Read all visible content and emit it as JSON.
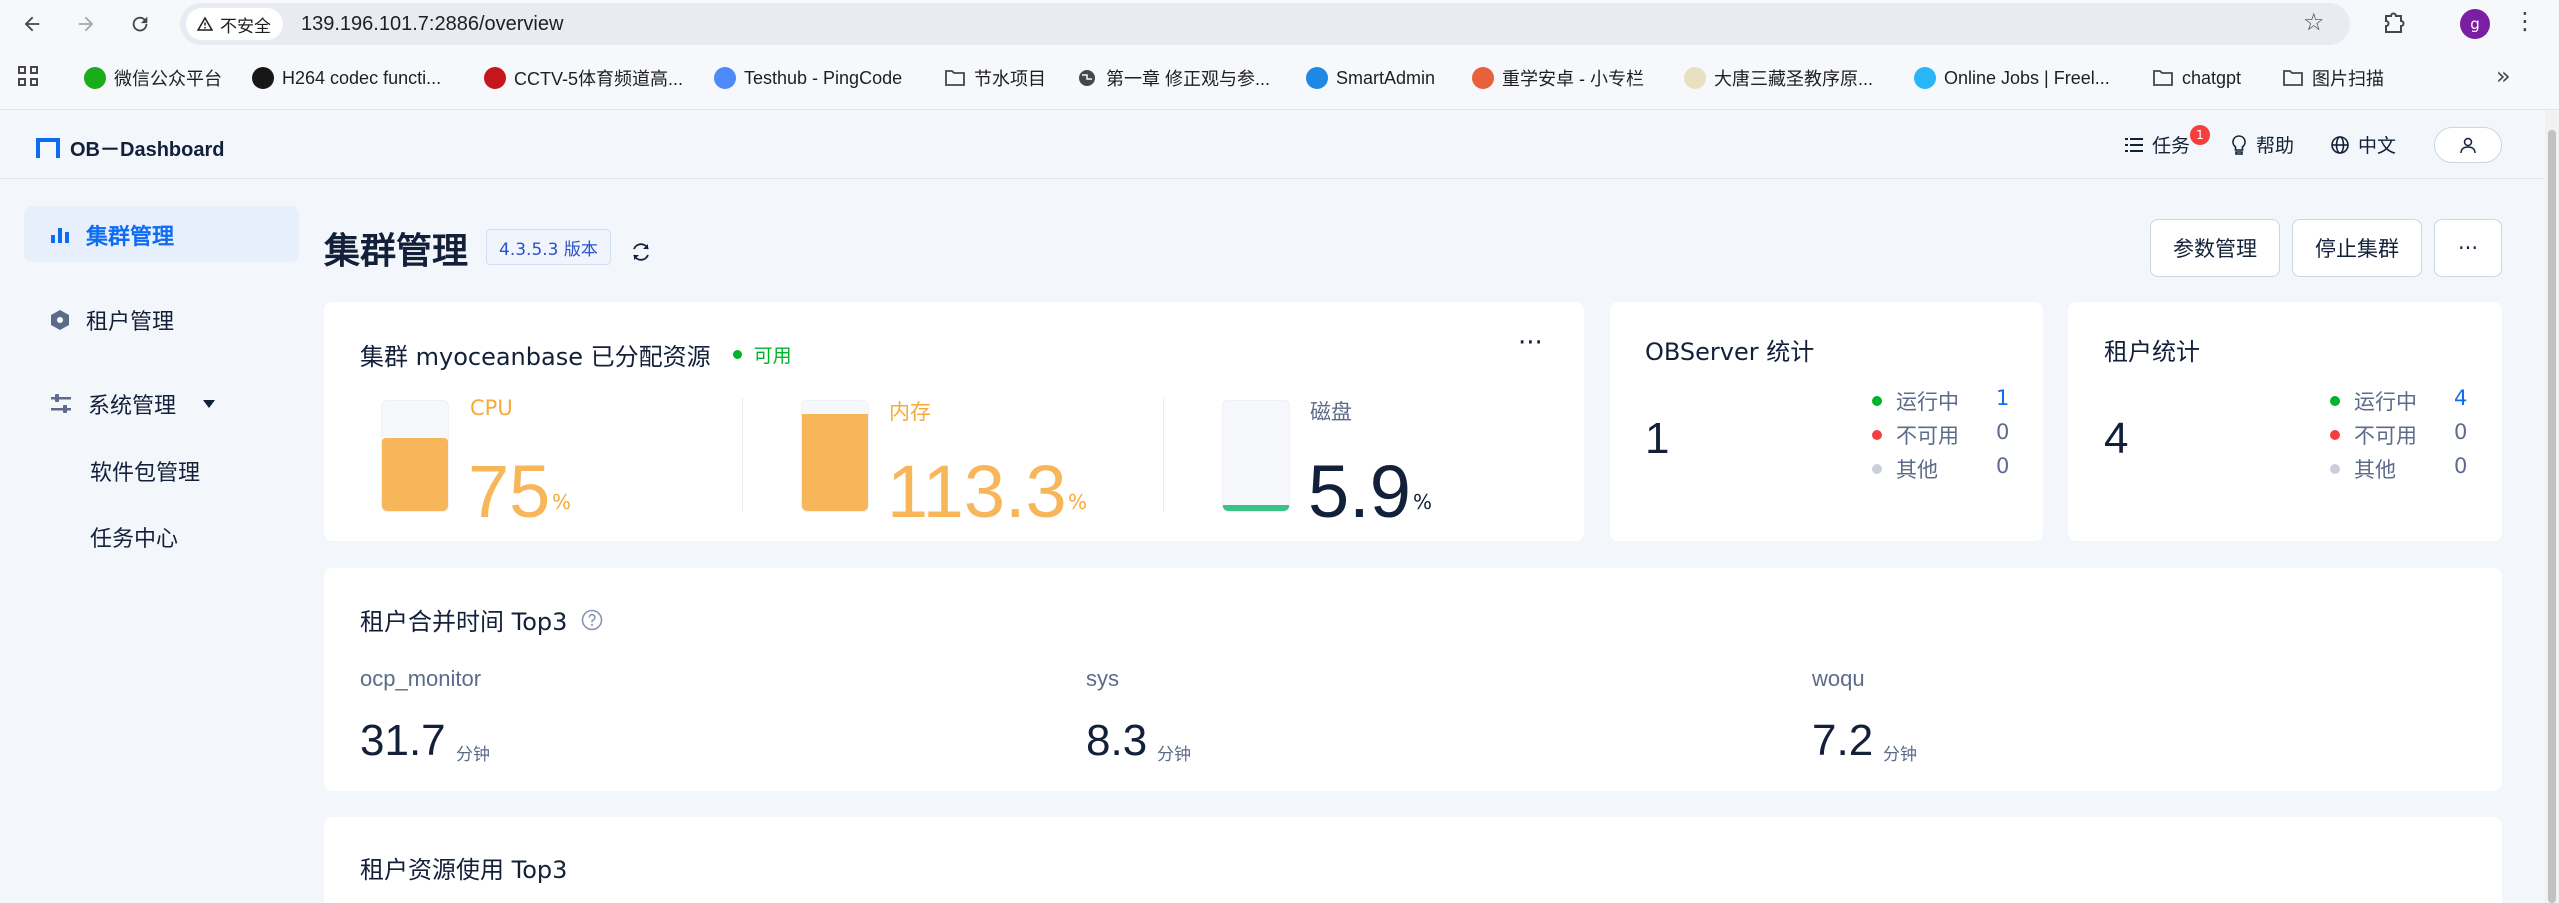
{
  "browser": {
    "insecure_label": "不安全",
    "url": "139.196.101.7:2886/overview",
    "profile_initial": "g"
  },
  "bookmarks": [
    {
      "label": "微信公众平台",
      "icon": "wechat-icon",
      "color": "#1aad19"
    },
    {
      "label": "H264 codec functi...",
      "icon": "github-icon",
      "color": "#181717"
    },
    {
      "label": "CCTV-5体育频道高...",
      "icon": "cctv-icon",
      "color": "#c4161c"
    },
    {
      "label": "Testhub - PingCode",
      "icon": "pingcode-icon",
      "color": "#4e8af7"
    },
    {
      "label": "节水项目",
      "icon": "folder-icon",
      "color": "#474747"
    },
    {
      "label": "第一章 修正观与参...",
      "icon": "globe-icon",
      "color": "#474747"
    },
    {
      "label": "SmartAdmin",
      "icon": "wifi-icon",
      "color": "#1e88e5"
    },
    {
      "label": "重学安卓 - 小专栏",
      "icon": "xiaozhuanlan-icon",
      "color": "#e8603c"
    },
    {
      "label": "大唐三藏圣教序原...",
      "icon": "gu-icon",
      "color": "#e8e0c0"
    },
    {
      "label": "Online Jobs | Freel...",
      "icon": "bird-icon",
      "color": "#29b6f6"
    },
    {
      "label": "chatgpt",
      "icon": "folder-icon",
      "color": "#474747"
    },
    {
      "label": "图片扫描",
      "icon": "folder-icon",
      "color": "#474747"
    }
  ],
  "header": {
    "logo": "OB－Dashboard",
    "tasks_label": "任务",
    "tasks_badge": "1",
    "help_label": "帮助",
    "lang_label": "中文"
  },
  "sidebar": {
    "items": [
      {
        "label": "集群管理",
        "icon": "bar-chart-icon",
        "active": true
      },
      {
        "label": "租户管理",
        "icon": "hexagon-icon"
      },
      {
        "label": "系统管理",
        "icon": "sliders-icon"
      },
      {
        "label": "软件包管理"
      },
      {
        "label": "任务中心"
      }
    ]
  },
  "main": {
    "title": "集群管理",
    "version": "4.3.5.3 版本",
    "buttons": {
      "params": "参数管理",
      "stop": "停止集群",
      "more": "···"
    }
  },
  "resources": {
    "title": "集群 myoceanbase 已分配资源",
    "status": "可用",
    "status_color": "#00b42a",
    "more": "···",
    "cpu": {
      "label": "CPU",
      "value": "75",
      "unit": "%",
      "fill_percent": 75,
      "color": "#f8b65a"
    },
    "memory": {
      "label": "内存",
      "value": "113.3",
      "unit": "%",
      "fill_percent": 100,
      "color": "#f8b65a"
    },
    "disk": {
      "label": "磁盘",
      "value": "5.9",
      "unit": "%",
      "fill_percent": 5.9,
      "color": "#3ac389"
    }
  },
  "observer_stats": {
    "title": "OBServer 统计",
    "total": "1",
    "legend": [
      {
        "label": "运行中",
        "value": "1",
        "color": "#00b42a"
      },
      {
        "label": "不可用",
        "value": "0",
        "color": "#f53f3f"
      },
      {
        "label": "其他",
        "value": "0",
        "color": "#c9cfdc"
      }
    ]
  },
  "tenant_stats": {
    "title": "租户统计",
    "total": "4",
    "legend": [
      {
        "label": "运行中",
        "value": "4",
        "color": "#00b42a"
      },
      {
        "label": "不可用",
        "value": "0",
        "color": "#f53f3f"
      },
      {
        "label": "其他",
        "value": "0",
        "color": "#c9cfdc"
      }
    ]
  },
  "merge_top3": {
    "title": "租户合并时间 Top3",
    "items": [
      {
        "name": "ocp_monitor",
        "value": "31.7",
        "unit": "分钟"
      },
      {
        "name": "sys",
        "value": "8.3",
        "unit": "分钟"
      },
      {
        "name": "woqu",
        "value": "7.2",
        "unit": "分钟"
      }
    ]
  },
  "resource_top3": {
    "title": "租户资源使用 Top3"
  }
}
